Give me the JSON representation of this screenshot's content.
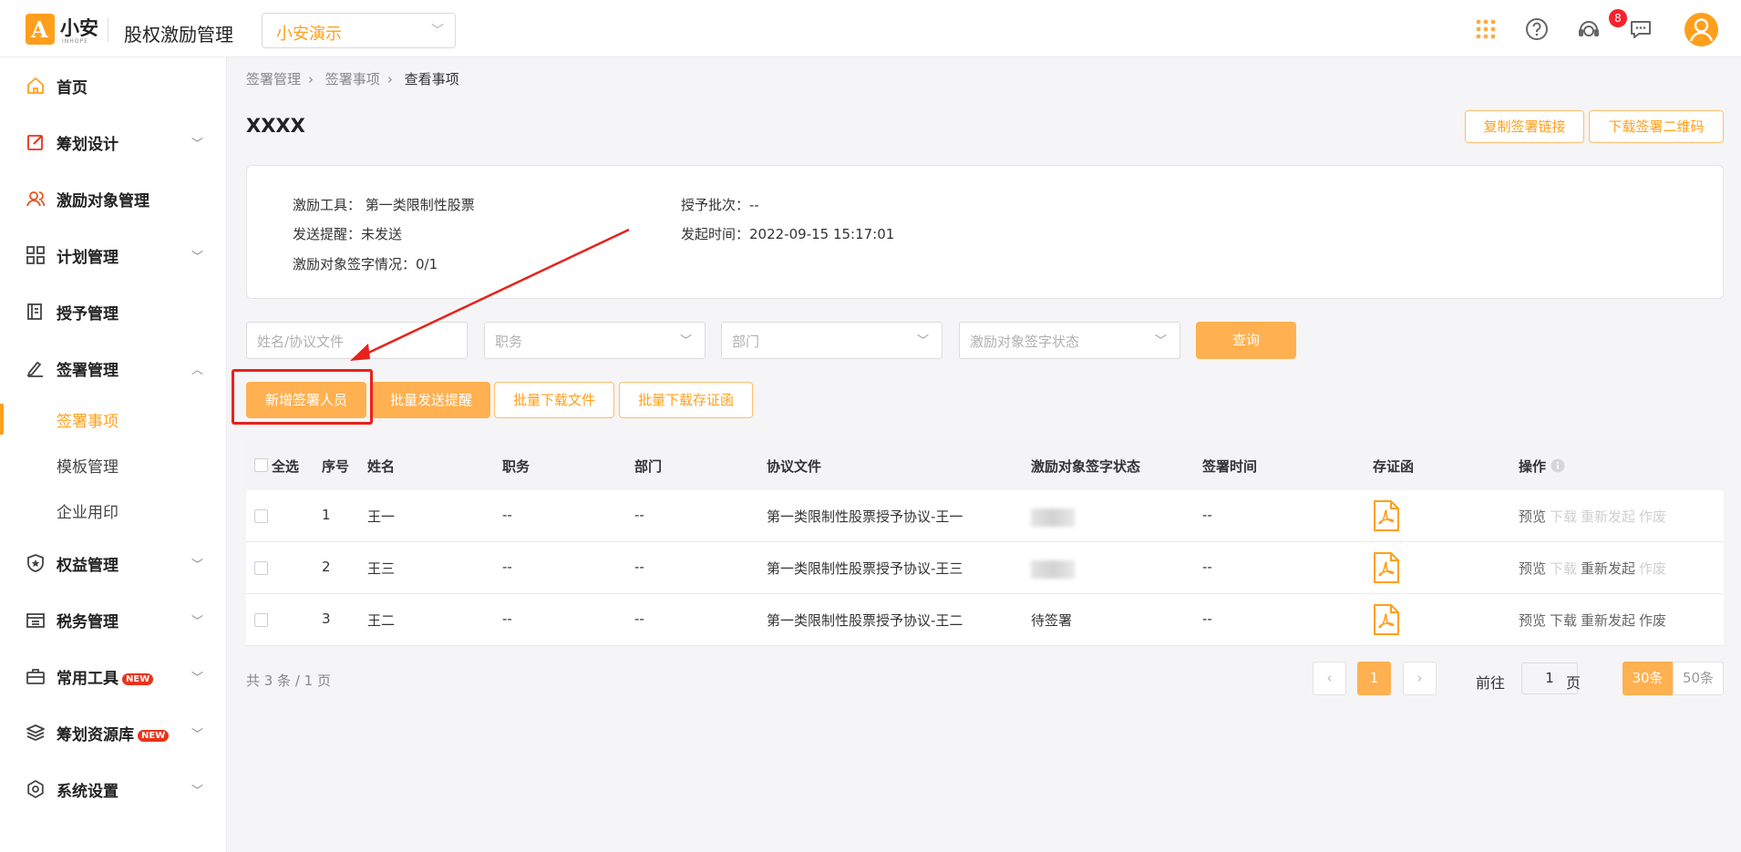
{
  "header": {
    "brand": "小安",
    "brand_sub": "INHOPE",
    "app_title": "股权激励管理",
    "org_select": "小安演示",
    "message_badge": "8"
  },
  "sidebar": {
    "items": [
      {
        "label": "首页"
      },
      {
        "label": "筹划设计"
      },
      {
        "label": "激励对象管理"
      },
      {
        "label": "计划管理"
      },
      {
        "label": "授予管理"
      },
      {
        "label": "签署管理"
      },
      {
        "label": "权益管理"
      },
      {
        "label": "税务管理"
      },
      {
        "label": "常用工具",
        "tag": "NEW"
      },
      {
        "label": "筹划资源库",
        "tag": "NEW"
      },
      {
        "label": "系统设置"
      }
    ],
    "sub_items": [
      {
        "label": "签署事项"
      },
      {
        "label": "模板管理"
      },
      {
        "label": "企业用印"
      }
    ]
  },
  "breadcrumb": [
    "签署管理",
    "签署事项",
    "查看事项"
  ],
  "page_title": "XXXX",
  "top_buttons": {
    "copy_link": "复制签署链接",
    "download_qr": "下载签署二维码"
  },
  "info": {
    "tool_label": "激励工具：",
    "tool_value": "第一类限制性股票",
    "batch_label": "授予批次：",
    "batch_value": "--",
    "remind_label": "发送提醒：",
    "remind_value": "未发送",
    "time_label": "发起时间：",
    "time_value": "2022-09-15 15:17:01",
    "sign_label": "激励对象签字情况：",
    "sign_value": "0/1"
  },
  "filters": {
    "name_placeholder": "姓名/协议文件",
    "position": "职务",
    "department": "部门",
    "status": "激励对象签字状态",
    "query": "查询"
  },
  "actions": {
    "add_signer": "新增签署人员",
    "batch_remind": "批量发送提醒",
    "batch_download": "批量下载文件",
    "batch_download_cert": "批量下载存证函"
  },
  "table": {
    "headers": {
      "select_all": "全选",
      "index": "序号",
      "name": "姓名",
      "position": "职务",
      "department": "部门",
      "file": "协议文件",
      "status": "激励对象签字状态",
      "time": "签署时间",
      "cert": "存证函",
      "ops": "操作"
    },
    "rows": [
      {
        "index": "1",
        "name": "王一",
        "position": "--",
        "department": "--",
        "file": "第一类限制性股票授予协议-王一",
        "status": "",
        "time": "--"
      },
      {
        "index": "2",
        "name": "王三",
        "position": "--",
        "department": "--",
        "file": "第一类限制性股票授予协议-王三",
        "status": "",
        "time": "--"
      },
      {
        "index": "3",
        "name": "王二",
        "position": "--",
        "department": "--",
        "file": "第一类限制性股票授予协议-王二",
        "status": "待签署",
        "time": "--"
      }
    ],
    "ops": {
      "preview": "预览",
      "download": "下载",
      "resend": "重新发起",
      "void": "作废"
    }
  },
  "pagination": {
    "total": "共 3 条 / 1 页",
    "current_page": "1",
    "goto_prefix": "前往",
    "goto_value": "1",
    "goto_suffix": "页",
    "size_30": "30条",
    "size_50": "50条"
  },
  "colors": {
    "accent": "#ff9f1c",
    "highlight_box": "#e8211b",
    "annotation_arrow": "#e8211b"
  }
}
